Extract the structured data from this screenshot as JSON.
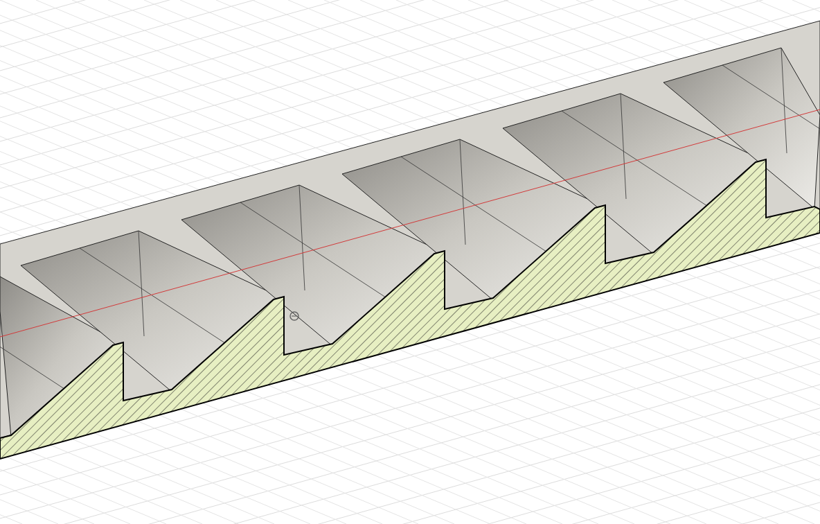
{
  "viewport": {
    "grid_visible": true,
    "section_hatch": true
  }
}
